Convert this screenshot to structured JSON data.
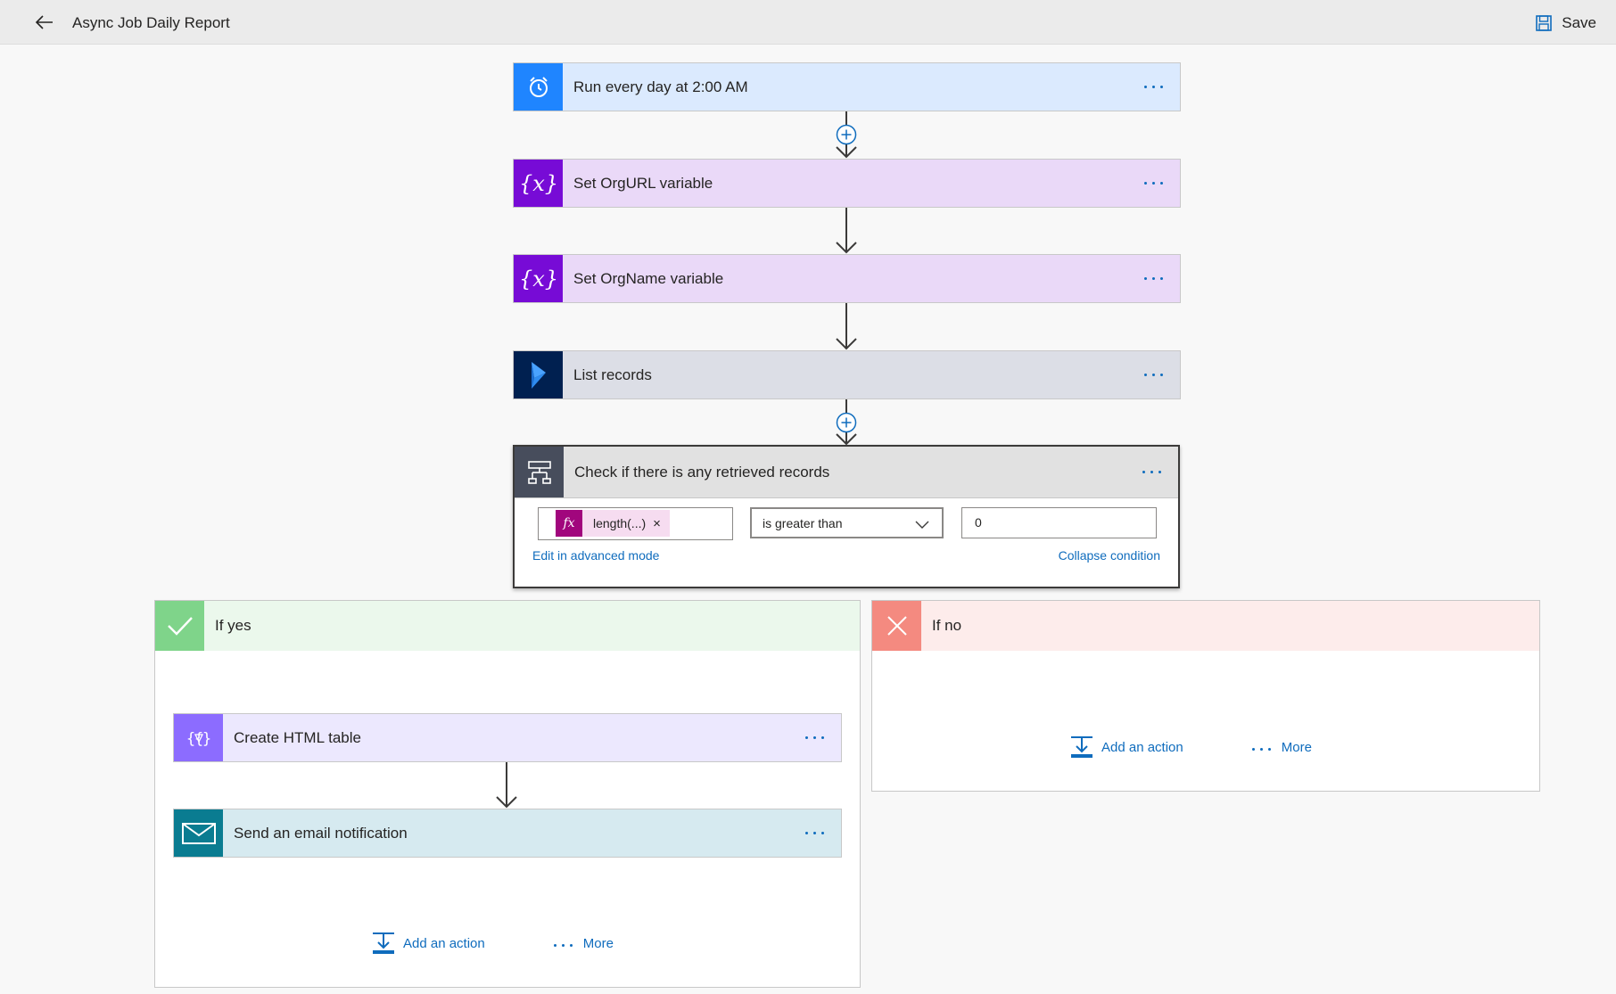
{
  "header": {
    "title": "Async Job Daily Report",
    "save_label": "Save"
  },
  "steps": [
    {
      "label": "Run every day at 2:00 AM",
      "icon": "alarm-clock-icon",
      "icon_color": "#1f85ff",
      "bg": "#dbeafe"
    },
    {
      "label": "Set OrgURL variable",
      "icon": "variable-icon",
      "icon_color": "#770bd6",
      "bg": "#ead9f8"
    },
    {
      "label": "Set OrgName variable",
      "icon": "variable-icon",
      "icon_color": "#770bd6",
      "bg": "#ead9f8"
    },
    {
      "label": "List records",
      "icon": "dynamics-icon",
      "icon_color": "#002050",
      "bg": "#dcdee6"
    }
  ],
  "condition": {
    "label": "Check if there is any retrieved records",
    "token": "length(...)",
    "token_remove": "×",
    "operator": "is greater than",
    "value": "0",
    "edit_advanced": "Edit in advanced mode",
    "collapse": "Collapse condition"
  },
  "branch_yes": {
    "label": "If yes",
    "color": "#7fd48a",
    "actions": [
      {
        "label": "Create HTML table",
        "icon": "data-operation-icon",
        "icon_color": "#8c6cff",
        "bg": "#ece8fe"
      },
      {
        "label": "Send an email notification",
        "icon": "mail-icon",
        "icon_color": "#0a7c91",
        "bg": "#d6eaf0"
      }
    ],
    "add_action": "Add an action",
    "more": "More"
  },
  "branch_no": {
    "label": "If no",
    "color": "#f48a80",
    "add_action": "Add an action",
    "more": "More"
  }
}
